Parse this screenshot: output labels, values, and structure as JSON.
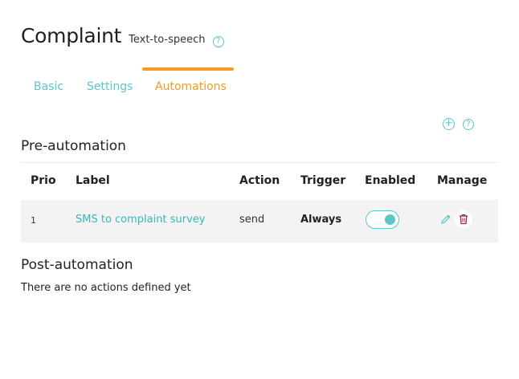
{
  "header": {
    "title": "Complaint",
    "subtitle": "Text-to-speech",
    "help_icon": "question-circle-icon"
  },
  "tabs": [
    {
      "label": "Basic",
      "active": false
    },
    {
      "label": "Settings",
      "active": false
    },
    {
      "label": "Automations",
      "active": true
    }
  ],
  "toolbar": {
    "add_icon": "plus-circle-icon",
    "help_icon": "question-circle-icon"
  },
  "pre_automation": {
    "title": "Pre-automation",
    "columns": [
      "Prio",
      "Label",
      "Action",
      "Trigger",
      "Enabled",
      "Manage"
    ],
    "rows": [
      {
        "prio": "1",
        "label": "SMS to complaint survey",
        "action": "send",
        "trigger": "Always",
        "enabled": true,
        "manage_icons": [
          "pencil-icon",
          "trash-icon"
        ]
      }
    ]
  },
  "post_automation": {
    "title": "Post-automation",
    "empty_text": "There are no actions defined yet"
  },
  "colors": {
    "accent": "#5cc6c9",
    "active_tab": "#f49a2a",
    "delete": "#a3283a",
    "row_background": "#f3f3f3"
  }
}
